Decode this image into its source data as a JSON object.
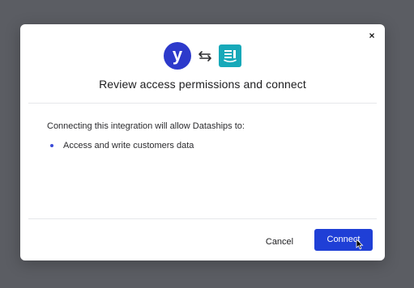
{
  "modal": {
    "close_label": "×",
    "title": "Review access permissions and connect",
    "intro": "Connecting this integration will allow Dataships to:",
    "permissions": [
      {
        "label": "Access and write customers data"
      }
    ],
    "buttons": {
      "cancel_label": "Cancel",
      "connect_label": "Connect"
    },
    "logos": {
      "source_letter": "y",
      "source_icon": "y-brand-logo",
      "swap_icon": "swap-arrows-icon",
      "target_icon": "dataships-logo"
    }
  },
  "colors": {
    "overlay": "#5b5d63",
    "accent": "#1f3fd6",
    "source_logo": "#2d3acb",
    "target_logo": "#17a9b9",
    "bullet": "#3b4bd8"
  }
}
